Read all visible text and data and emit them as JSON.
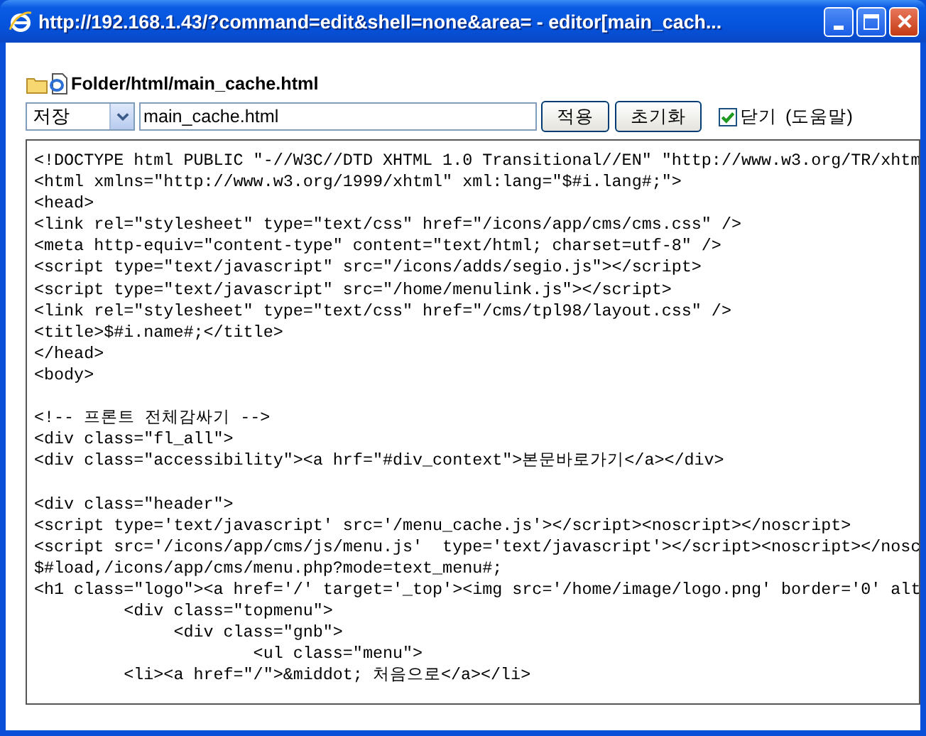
{
  "window": {
    "title": "http://192.168.1.43/?command=edit&shell=none&area= - editor[main_cach..."
  },
  "path": "Folder/html/main_cache.html",
  "toolbar": {
    "mode_select": {
      "value": "저장"
    },
    "filename_field": {
      "value": "main_cache.html"
    },
    "buttons": [
      "적용",
      "초기화"
    ],
    "close_checkbox": {
      "label": "닫기",
      "checked": true
    },
    "help_link": "(도움말)"
  },
  "editor": {
    "lines": [
      {
        "kind": "code",
        "text": "<!DOCTYPE html PUBLIC \"-//W3C//DTD XHTML 1.0 Transitional//EN\" \"http://www.w3.org/TR/xhtm"
      },
      {
        "kind": "code",
        "text": "<html xmlns=\"http://www.w3.org/1999/xhtml\" xml:lang=\"$#i.lang#;\">"
      },
      {
        "kind": "code",
        "text": "<head>"
      },
      {
        "kind": "code",
        "text": "<link rel=\"stylesheet\" type=\"text/css\" href=\"/icons/app/cms/cms.css\" />"
      },
      {
        "kind": "code",
        "text": "<meta http-equiv=\"content-type\" content=\"text/html; charset=utf-8\" />"
      },
      {
        "kind": "code",
        "text": "<script type=\"text/javascript\" src=\"/icons/adds/segio.js\"></script>"
      },
      {
        "kind": "code",
        "text": "<script type=\"text/javascript\" src=\"/home/menulink.js\"></script>"
      },
      {
        "kind": "code",
        "text": "<link rel=\"stylesheet\" type=\"text/css\" href=\"/cms/tpl98/layout.css\" />"
      },
      {
        "kind": "code",
        "text": "<title>$#i.name#;</title>"
      },
      {
        "kind": "code",
        "text": "</head>"
      },
      {
        "kind": "code",
        "text": "<body>"
      },
      {
        "kind": "blank"
      },
      {
        "kind": "code",
        "text": "<!-- 프론트 전체감싸기 -->"
      },
      {
        "kind": "code",
        "text": "<div class=\"fl_all\">"
      },
      {
        "kind": "code",
        "text": "<div class=\"accessibility\"><a hrf=\"#div_context\">본문바로가기</a></div>"
      },
      {
        "kind": "blank"
      },
      {
        "kind": "code",
        "text": "<div class=\"header\">"
      },
      {
        "kind": "code",
        "text": "<script type='text/javascript' src='/menu_cache.js'></script><noscript></noscript>"
      },
      {
        "kind": "code",
        "text": "<script src='/icons/app/cms/js/menu.js'  type='text/javascript'></script><noscript></nosc"
      },
      {
        "kind": "code",
        "text": "$#load,/icons/app/cms/menu.php?mode=text_menu#;"
      },
      {
        "kind": "code",
        "text": "<h1 class=\"logo\"><a href='/' target='_top'><img src='/home/image/logo.png' border='0' alt"
      },
      {
        "kind": "code",
        "text": "         <div class=\"topmenu\">"
      },
      {
        "kind": "code",
        "text": "              <div class=\"gnb\">"
      },
      {
        "kind": "code",
        "text": "                      <ul class=\"menu\">"
      },
      {
        "kind": "code",
        "text": "         <li><a href=\"/\">&middot; 처음으로</a></li>"
      }
    ]
  }
}
